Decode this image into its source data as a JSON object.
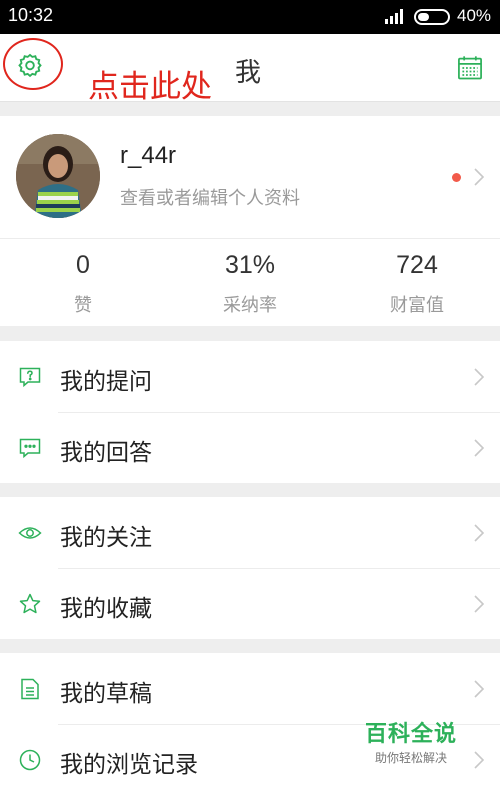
{
  "status_bar": {
    "time": "10:32",
    "battery_text": "40%",
    "battery_level": 0.4
  },
  "header": {
    "title": "我",
    "annotation": "点击此处",
    "settings_icon": "gear-icon",
    "calendar_icon": "calendar-icon"
  },
  "profile": {
    "username": "r_44r",
    "subtitle": "查看或者编辑个人资料"
  },
  "stats": [
    {
      "value": "0",
      "label": "赞"
    },
    {
      "value": "31%",
      "label": "采纳率"
    },
    {
      "value": "724",
      "label": "财富值"
    }
  ],
  "menu": {
    "my_questions": "我的提问",
    "my_answers": "我的回答",
    "my_follows": "我的关注",
    "my_favorites": "我的收藏",
    "my_drafts": "我的草稿",
    "my_history": "我的浏览记录"
  },
  "watermark": {
    "title": "百科全说",
    "subtitle": "助你轻松解决"
  },
  "colors": {
    "accent": "#2db15a",
    "annotation_red": "#e0261d",
    "notice_dot": "#f25a4a"
  }
}
